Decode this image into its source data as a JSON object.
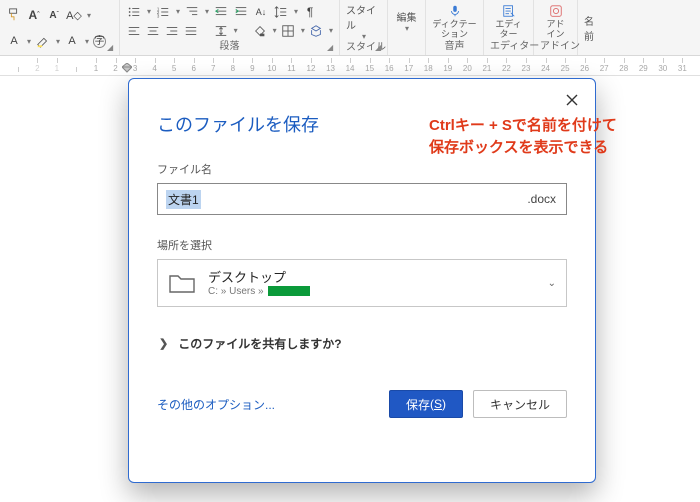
{
  "ribbon": {
    "groups": {
      "font": {
        "label": ""
      },
      "paragraph": {
        "label": "段落"
      },
      "styles": {
        "label_small": "スタイル",
        "label_top": "スタイル"
      },
      "editing": {
        "label_top": "編集"
      },
      "dictation": {
        "label_top": "ディクテー",
        "label_bottom": "ション",
        "group_label": "音声"
      },
      "editor": {
        "label_top": "エディ",
        "label_bottom": "ター",
        "group_label": "エディター"
      },
      "addin": {
        "label_top": "アド",
        "label_bottom": "イン",
        "group_label": "アドイン"
      },
      "name": {
        "label": "名前"
      }
    }
  },
  "ruler": {
    "ticks": [
      "",
      "1",
      "2",
      "3",
      "4",
      "5",
      "6",
      "7",
      "8",
      "9",
      "10",
      "11",
      "12",
      "13",
      "14",
      "15",
      "16",
      "17",
      "18",
      "19",
      "20",
      "21",
      "22",
      "23",
      "24",
      "25",
      "26",
      "27",
      "28",
      "29",
      "30",
      "31"
    ]
  },
  "dialog": {
    "title": "このファイルを保存",
    "filename_label": "ファイル名",
    "filename_value": "文書1",
    "extension": ".docx",
    "location_label": "場所を選択",
    "location_name": "デスクトップ",
    "location_path_prefix": "C: » Users »",
    "share_label": "このファイルを共有しますか?",
    "more_options": "その他のオプション...",
    "save_button": "保存",
    "save_accel": "S",
    "cancel_button": "キャンセル"
  },
  "annotation": {
    "line1": "Ctrlキー + Sで名前を付けて",
    "line2": "保存ボックスを表示できる"
  }
}
